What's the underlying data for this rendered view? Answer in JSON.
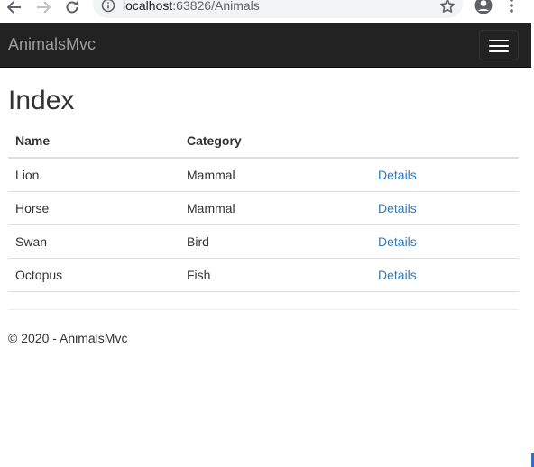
{
  "browser": {
    "url_host": "localhost",
    "url_port": ":63826",
    "url_path": "/Animals"
  },
  "navbar": {
    "brand": "AnimalsMvc"
  },
  "main": {
    "title": "Index",
    "table": {
      "headers": [
        "Name",
        "Category",
        ""
      ],
      "rows": [
        {
          "name": "Lion",
          "category": "Mammal",
          "link": "Details"
        },
        {
          "name": "Horse",
          "category": "Mammal",
          "link": "Details"
        },
        {
          "name": "Swan",
          "category": "Bird",
          "link": "Details"
        },
        {
          "name": "Octopus",
          "category": "Fish",
          "link": "Details"
        }
      ]
    }
  },
  "footer": {
    "text": "© 2020 - AnimalsMvc"
  },
  "colors": {
    "navbar_bg": "#222222",
    "brand_text": "#9d9d9d",
    "link": "#337ab7",
    "text": "#333333"
  },
  "icons": [
    "back-arrow-icon",
    "forward-arrow-icon",
    "reload-icon",
    "info-icon",
    "star-icon",
    "profile-icon",
    "more-vert-icon",
    "hamburger-icon"
  ]
}
